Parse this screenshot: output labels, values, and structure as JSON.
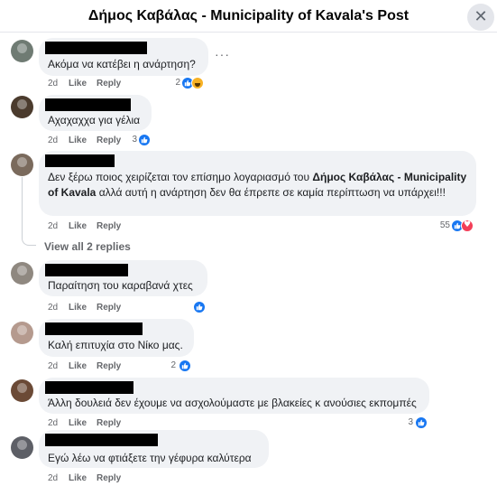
{
  "header": {
    "title": "Δήμος Καβάλας - Municipality of Kavala's Post",
    "close_icon": "close-icon"
  },
  "labels": {
    "like": "Like",
    "reply": "Reply"
  },
  "colors": {
    "like_blue": "#1877f2",
    "bubble_bg": "#f0f2f5",
    "meta_gray": "#65676b"
  },
  "comments": [
    {
      "text": "Ακόμα να κατέβει η ανάρτηση?",
      "time": "2d",
      "reaction_count": "2",
      "reactions": [
        "like-icon",
        "haha-icon"
      ]
    },
    {
      "text": "Αχαχαχχα για γέλια",
      "time": "2d",
      "reaction_count": "3",
      "reactions": [
        "like-icon"
      ]
    },
    {
      "text_pre": "Δεν ξέρω ποιος χειρίζεται τον επίσημο λογαριασμό του ",
      "text_bold": "Δήμος Καβάλας - Municipality of Kavala",
      "text_post": " αλλά αυτή η ανάρτηση δεν θα έπρεπε σε καμία περίπτωση να υπάρχει!!!",
      "time": "2d",
      "reaction_count": "55",
      "reactions": [
        "like-icon",
        "love-icon"
      ],
      "view_replies": "View all 2 replies"
    },
    {
      "text": "Παραίτηση του καραβανά χτες",
      "time": "2d",
      "reaction_count": "",
      "reactions": [
        "like-icon"
      ]
    },
    {
      "text": "Καλή επιτυχία στο Νίκο μας.",
      "time": "2d",
      "reaction_count": "2",
      "reactions": [
        "like-icon"
      ]
    },
    {
      "text": "Άλλη δουλειά δεν έχουμε να ασχολούμαστε με βλακείες κ ανούσιες εκπομπές",
      "time": "2d",
      "reaction_count": "3",
      "reactions": [
        "like-icon"
      ]
    },
    {
      "text": "Εγώ λέω να φτιάξετε την γέφυρα καλύτερα",
      "time": "2d",
      "reaction_count": "",
      "reactions": []
    }
  ]
}
